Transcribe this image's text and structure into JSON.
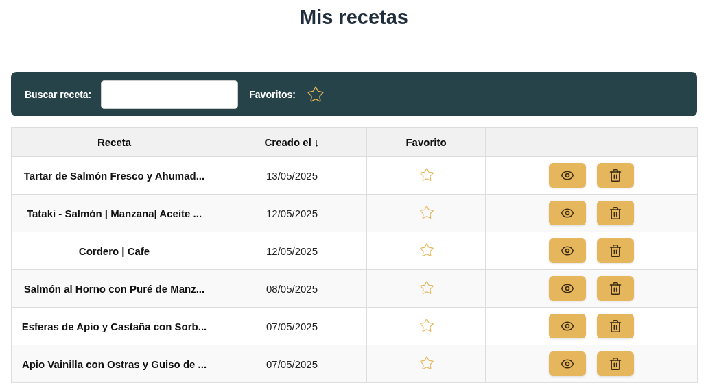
{
  "title": "Mis recetas",
  "filter_bar": {
    "search_label": "Buscar receta:",
    "favorites_label": "Favoritos:",
    "favorites_only": false
  },
  "table": {
    "columns": [
      "Receta",
      "Creado el ↓",
      "Favorito"
    ],
    "rows": [
      {
        "name": "Tartar de Salmón Fresco y Ahumad...",
        "created": "13/05/2025",
        "favorite": false
      },
      {
        "name": "Tataki - Salmón | Manzana| Aceite ...",
        "created": "12/05/2025",
        "favorite": false
      },
      {
        "name": "Cordero | Cafe",
        "created": "12/05/2025",
        "favorite": false
      },
      {
        "name": "Salmón al Horno con Puré de Manz...",
        "created": "08/05/2025",
        "favorite": false
      },
      {
        "name": "Esferas de Apio y Castaña con Sorb...",
        "created": "07/05/2025",
        "favorite": false
      },
      {
        "name": "Apio Vainilla con Ostras y Guiso de ...",
        "created": "07/05/2025",
        "favorite": false
      }
    ]
  }
}
